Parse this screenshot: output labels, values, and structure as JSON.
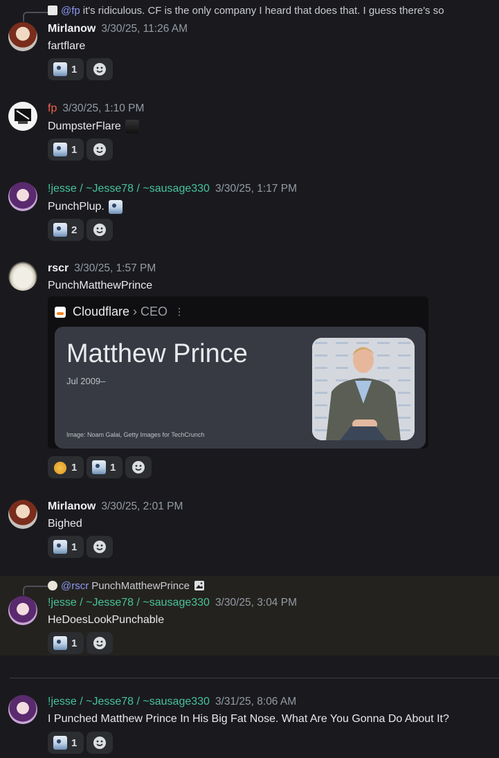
{
  "reply_top": {
    "mention": "@fp",
    "text": "it's ridiculous. CF is the only company I heard that does that. I guess there's so"
  },
  "messages": [
    {
      "username": "Mirlanow",
      "timestamp": "3/30/25, 11:26 AM",
      "content": "fartflare",
      "reactions": [
        {
          "emoji": "penguin",
          "count": "1"
        }
      ]
    },
    {
      "username": "fp",
      "timestamp": "3/30/25, 1:10 PM",
      "content": "DumpsterFlare",
      "reactions": [
        {
          "emoji": "penguin",
          "count": "1"
        }
      ]
    },
    {
      "username": "!jesse / ~Jesse78 / ~sausage330",
      "timestamp": "3/30/25, 1:17 PM",
      "content": "PunchPlup.",
      "reactions": [
        {
          "emoji": "penguin",
          "count": "2"
        }
      ]
    },
    {
      "username": "rscr",
      "timestamp": "3/30/25, 1:57 PM",
      "content": "PunchMatthewPrince",
      "embed": {
        "source": "Cloudflare",
        "separator": "›",
        "section": "CEO",
        "more": "⋮",
        "name": "Matthew Prince",
        "date": "Jul 2009–",
        "credit": "Image: Noam Galai, Getty Images for TechCrunch"
      },
      "reactions": [
        {
          "emoji": "handshake",
          "count": "1"
        },
        {
          "emoji": "penguin",
          "count": "1"
        }
      ]
    },
    {
      "username": "Mirlanow",
      "timestamp": "3/30/25, 2:01 PM",
      "content": "Bighed",
      "reactions": [
        {
          "emoji": "penguin",
          "count": "1"
        }
      ]
    },
    {
      "reply": {
        "mention": "@rscr",
        "text": "PunchMatthewPrince"
      },
      "username": "!jesse / ~Jesse78 / ~sausage330",
      "timestamp": "3/30/25, 3:04 PM",
      "content": "HeDoesLookPunchable",
      "reactions": [
        {
          "emoji": "penguin",
          "count": "1"
        }
      ]
    },
    {
      "username": "!jesse / ~Jesse78 / ~sausage330",
      "timestamp": "3/31/25, 8:06 AM",
      "content": "I Punched Matthew Prince In His Big Fat Nose. What Are You Gonna Do About It?",
      "reactions": [
        {
          "emoji": "penguin",
          "count": "1"
        }
      ]
    }
  ],
  "colors": {
    "background": "#1a1a1e",
    "highlight": "#24221f",
    "fp_name": "#f0624d",
    "jesse_name": "#47c39a",
    "mention": "#8c97f5"
  }
}
